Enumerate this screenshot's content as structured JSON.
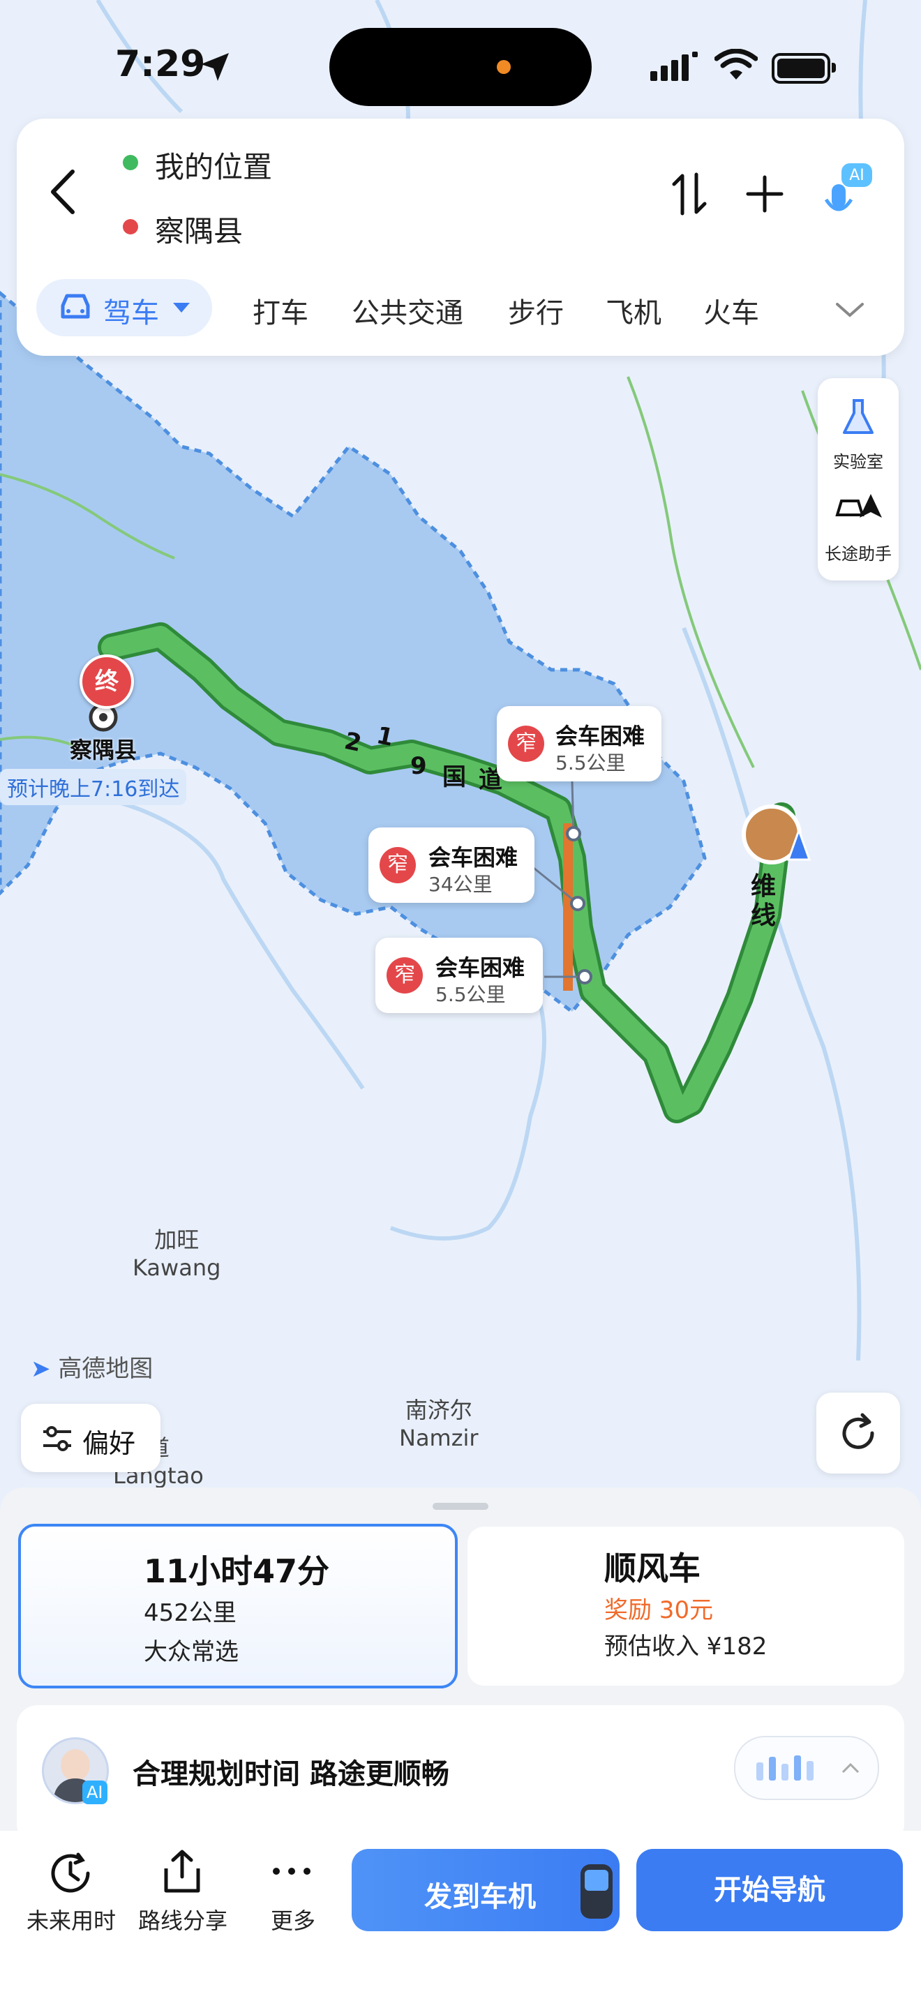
{
  "status_bar": {
    "time": "7:29"
  },
  "route": {
    "origin": "我的位置",
    "destination": "察隅县"
  },
  "modes": {
    "selected": "驾车",
    "items": [
      "打车",
      "公共交通",
      "步行",
      "飞机",
      "火车"
    ]
  },
  "side_tools": {
    "lab": "实验室",
    "long_trip": "长途助手"
  },
  "map": {
    "dest_marker": "终",
    "dest_name": "察隅县",
    "eta": "预计晚上7:16到达",
    "road_chars": [
      "2",
      "1",
      "9",
      "国",
      "道"
    ],
    "weixian": [
      "维",
      "线"
    ],
    "place1_cn": "加旺",
    "place1_en": "Kawang",
    "place2_cn": "南济尔",
    "place2_en": "Namzir",
    "place3_cn": "道",
    "place3_en": "Langtao",
    "logo_text": "高德地图",
    "warnings": [
      {
        "icon": "窄",
        "title": "会车困难",
        "dist": "5.5公里"
      },
      {
        "icon": "窄",
        "title": "会车困难",
        "dist": "34公里"
      },
      {
        "icon": "窄",
        "title": "会车困难",
        "dist": "5.5公里"
      }
    ]
  },
  "preference_label": "偏好",
  "plan": {
    "duration": "11小时47分",
    "distance": "452公里",
    "tag": "大众常选"
  },
  "carpool": {
    "title": "顺风车",
    "reward": "奖励 30元",
    "income": "预估收入 ¥182"
  },
  "ai_tip": {
    "badge": "AI",
    "text": "合理规划时间 路途更顺畅"
  },
  "toolbar": {
    "future": "未来用时",
    "share": "路线分享",
    "more": "更多",
    "send": "发到车机",
    "navigate": "开始导航"
  },
  "colors": {
    "accent": "#3b7cf3",
    "route": "#4caf5a",
    "warning": "#e4474a",
    "reward": "#f06a2a"
  }
}
